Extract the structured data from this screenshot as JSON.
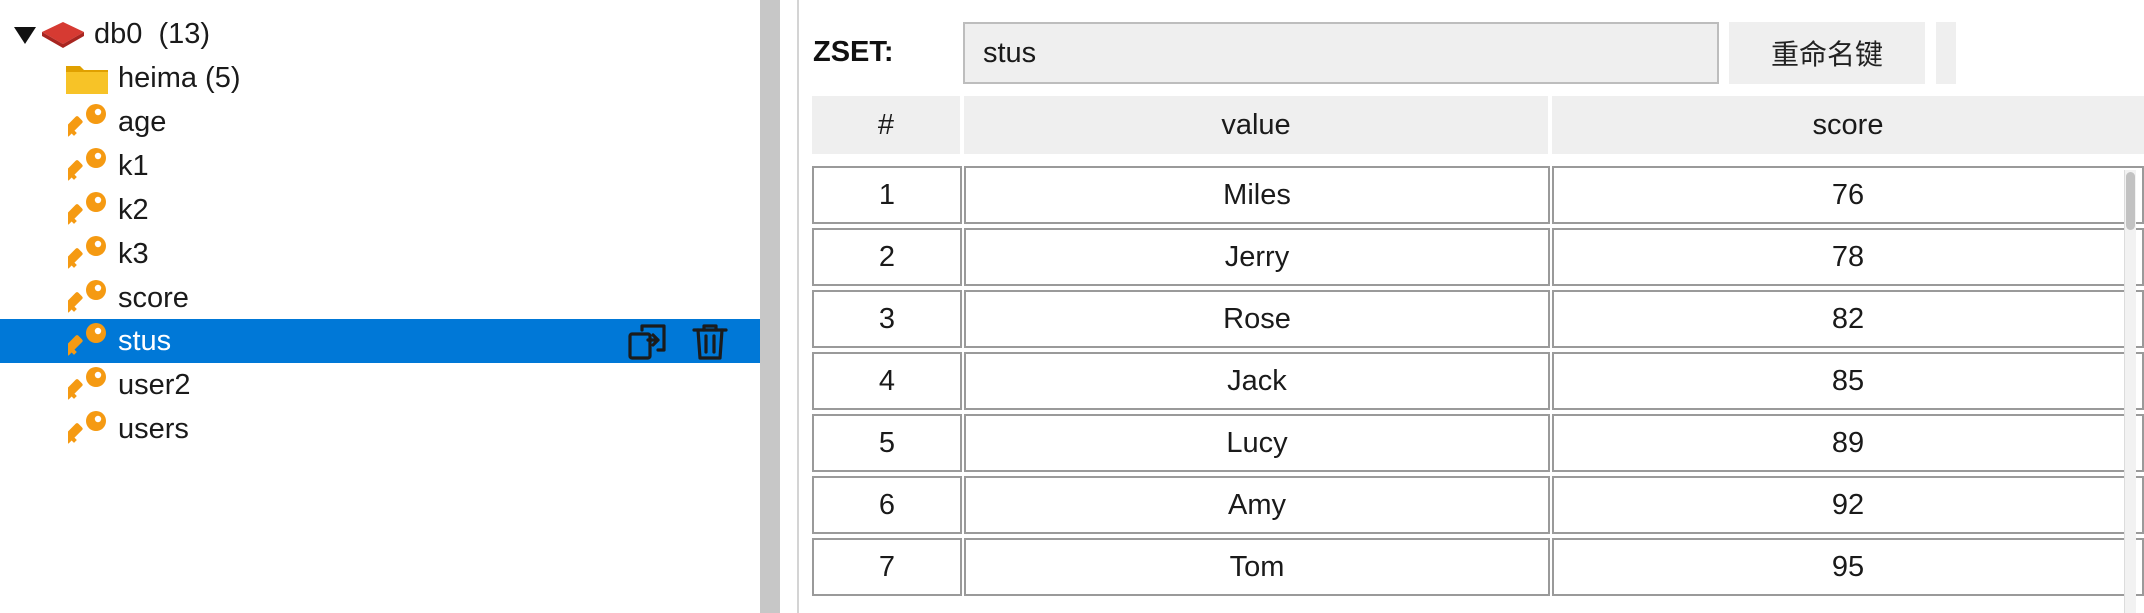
{
  "tree": {
    "db": {
      "label": "db0",
      "count": "(13)"
    },
    "items": [
      {
        "type": "folder",
        "label": "heima (5)"
      },
      {
        "type": "key",
        "label": "age"
      },
      {
        "type": "key",
        "label": "k1"
      },
      {
        "type": "key",
        "label": "k2"
      },
      {
        "type": "key",
        "label": "k3"
      },
      {
        "type": "key",
        "label": "score"
      },
      {
        "type": "key",
        "label": "stus",
        "selected": true
      },
      {
        "type": "key",
        "label": "user2"
      },
      {
        "type": "key",
        "label": "users"
      }
    ],
    "selected_actions": [
      "copy-icon",
      "trash-icon"
    ],
    "colors": {
      "selected_bg": "#0078d7",
      "key_icon": "#f59a12",
      "folder_icon": "#f5b400",
      "db_icon": "#d63a32"
    }
  },
  "detail": {
    "type_label": "ZSET:",
    "key_name": "stus",
    "rename_label": "重命名键",
    "columns": [
      "#",
      "value",
      "score"
    ],
    "rows": [
      {
        "index": "1",
        "value": "Miles",
        "score": "76"
      },
      {
        "index": "2",
        "value": "Jerry",
        "score": "78"
      },
      {
        "index": "3",
        "value": "Rose",
        "score": "82"
      },
      {
        "index": "4",
        "value": "Jack",
        "score": "85"
      },
      {
        "index": "5",
        "value": "Lucy",
        "score": "89"
      },
      {
        "index": "6",
        "value": "Amy",
        "score": "92"
      },
      {
        "index": "7",
        "value": "Tom",
        "score": "95"
      }
    ]
  }
}
